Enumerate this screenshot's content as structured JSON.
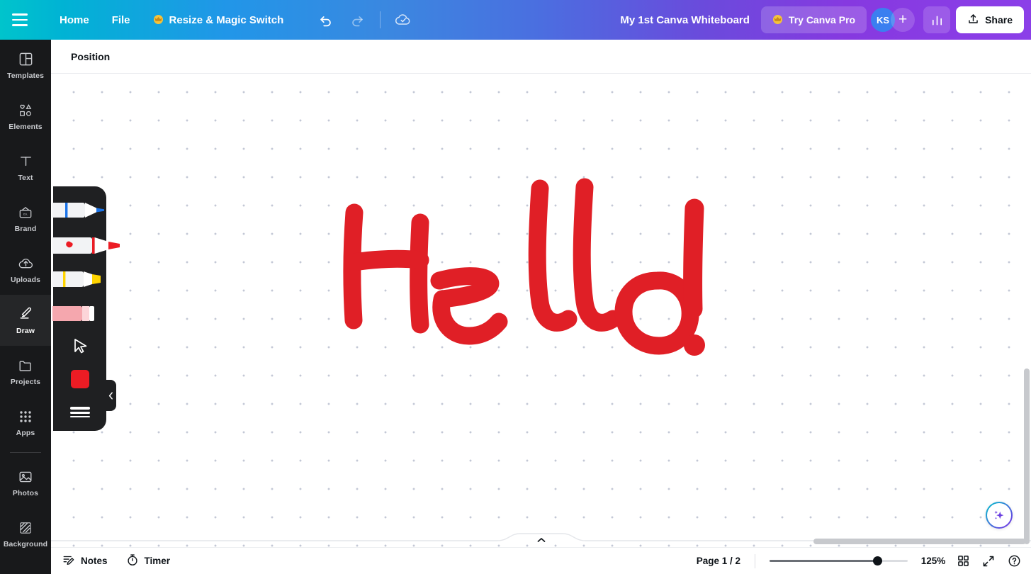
{
  "topbar": {
    "menu_icon": "hamburger-icon",
    "home_label": "Home",
    "file_label": "File",
    "resize_label": "Resize & Magic Switch",
    "resize_crown": "♛",
    "undo_icon": "undo-icon",
    "redo_icon": "redo-icon",
    "saved_icon": "cloud-check-icon",
    "doc_title": "My 1st Canva Whiteboard",
    "try_pro_label": "Try Canva Pro",
    "try_pro_crown": "♛",
    "avatar_initials": "KS",
    "add_collaborator": "+",
    "insights_icon": "bar-chart-icon",
    "share_label": "Share",
    "share_icon": "upload-icon",
    "gradient_start": "#00c4cc",
    "gradient_mid": "#3b87e0",
    "gradient_end": "#8b3fe8"
  },
  "sidebar": {
    "items": [
      {
        "label": "Templates",
        "icon": "templates-icon",
        "active": false
      },
      {
        "label": "Elements",
        "icon": "elements-icon",
        "active": false
      },
      {
        "label": "Text",
        "icon": "text-icon",
        "active": false
      },
      {
        "label": "Brand",
        "icon": "brand-icon",
        "active": false
      },
      {
        "label": "Uploads",
        "icon": "uploads-icon",
        "active": false
      },
      {
        "label": "Draw",
        "icon": "draw-icon",
        "active": true
      },
      {
        "label": "Projects",
        "icon": "projects-icon",
        "active": false
      },
      {
        "label": "Apps",
        "icon": "apps-icon",
        "active": false
      },
      {
        "label": "Photos",
        "icon": "photos-icon",
        "active": false
      },
      {
        "label": "Background",
        "icon": "background-icon",
        "active": false
      }
    ]
  },
  "position_bar": {
    "position_label": "Position"
  },
  "draw_panel": {
    "tools": [
      {
        "name": "pen",
        "color": "#1a73e8",
        "selected": false
      },
      {
        "name": "marker",
        "color": "#ec1c24",
        "selected": true
      },
      {
        "name": "highlighter",
        "color": "#ffd400",
        "selected": false
      },
      {
        "name": "eraser",
        "color": "#f5a7ae",
        "selected": false
      }
    ],
    "select_tool": "cursor-arrow-icon",
    "active_color": "#ec1c24",
    "thickness_icon": "stroke-thickness-icon",
    "collapse_icon": "chevron-left-icon"
  },
  "canvas": {
    "artwork_text": "Hello!",
    "ink_color": "#e01f26",
    "dot_color": "#c3c8d6",
    "page_collapse_icon": "chevron-up-icon",
    "magic_icon": "magic-sparkle-icon"
  },
  "bottombar": {
    "notes_label": "Notes",
    "notes_icon": "notes-pencil-icon",
    "timer_label": "Timer",
    "timer_icon": "stopwatch-icon",
    "page_indicator": "Page 1 / 2",
    "zoom_value": "125%",
    "zoom_percent": 78,
    "grid_view_icon": "grid-view-icon",
    "fullscreen_icon": "expand-icon",
    "help_icon": "help-question-icon"
  }
}
